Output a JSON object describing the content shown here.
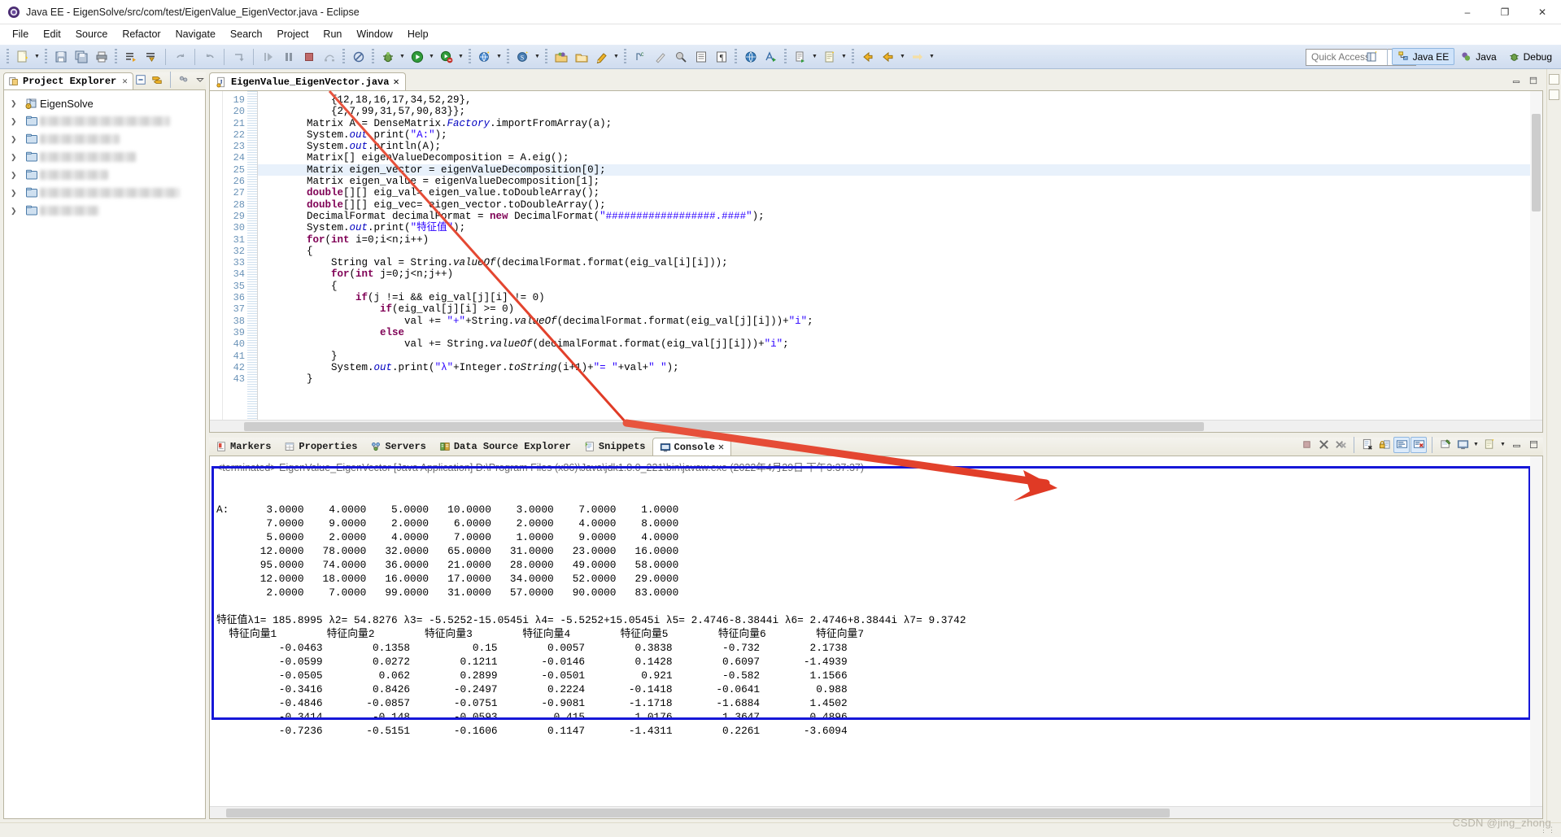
{
  "window": {
    "title": "Java EE - EigenSolve/src/com/test/EigenValue_EigenVector.java - Eclipse",
    "app_icon": "eclipse-icon",
    "minimize": "–",
    "maximize": "❐",
    "close": "✕"
  },
  "menubar": {
    "items": [
      "File",
      "Edit",
      "Source",
      "Refactor",
      "Navigate",
      "Search",
      "Project",
      "Run",
      "Window",
      "Help"
    ]
  },
  "toolbar": {
    "quick_access_placeholder": "Quick Access",
    "perspectives": [
      {
        "label": "Java EE",
        "icon": "java-ee-perspective-icon",
        "active": true
      },
      {
        "label": "Java",
        "icon": "java-perspective-icon",
        "active": false
      },
      {
        "label": "Debug",
        "icon": "debug-perspective-icon",
        "active": false
      }
    ],
    "open_perspective_icon": "open-perspective-icon",
    "buttons": [
      "new-icon",
      "save-icon",
      "save-all-icon",
      "print-icon",
      "build-all-icon",
      "skip-breakpoints-icon",
      "undo-icon",
      "redo-icon",
      "next-annotation-icon",
      "resume-icon",
      "suspend-icon",
      "terminate-icon",
      "step-icon",
      "disconnect-icon",
      "debug-icon",
      "run-icon",
      "run-error-icon",
      "new-java-ee-project-icon",
      "new-server-icon",
      "open-type-icon",
      "open-task-icon",
      "new-class-icon",
      "toggle-mark-occurrences-icon",
      "pencil-icon",
      "search-icon",
      "show-whitespace-icon",
      "pilcrow-icon",
      "web-browser-icon",
      "run-as-icon",
      "external-tools-icon",
      "new-wizard-icon",
      "back-icon",
      "forward-icon",
      "next-icon"
    ]
  },
  "project_explorer": {
    "title": "Project Explorer",
    "icon": "project-explorer-icon",
    "close_icon": "close-icon",
    "view_buttons": [
      "collapse-all-icon",
      "link-with-editor-icon",
      "view-menu-icon",
      "minimize-icon",
      "maximize-icon"
    ],
    "items": [
      {
        "label": "EigenSolve",
        "icon": "java-project-icon",
        "blurred": false,
        "blur_width": 0
      },
      {
        "label": "",
        "icon": "folder-icon",
        "blurred": true,
        "blur_width": 160
      },
      {
        "label": "",
        "icon": "folder-icon",
        "blurred": true,
        "blur_width": 98
      },
      {
        "label": "",
        "icon": "folder-icon",
        "blurred": true,
        "blur_width": 118
      },
      {
        "label": "",
        "icon": "folder-icon",
        "blurred": true,
        "blur_width": 84
      },
      {
        "label": "",
        "icon": "folder-icon",
        "blurred": true,
        "blur_width": 172
      },
      {
        "label": "",
        "icon": "folder-icon",
        "blurred": true,
        "blur_width": 73
      }
    ]
  },
  "editor": {
    "tab": {
      "label": "EigenValue_EigenVector.java",
      "icon": "java-file-icon",
      "close_icon": "close-icon"
    },
    "first_line_number": 19,
    "highlighted_line": 25,
    "lines": [
      {
        "n": 19,
        "indent": 12,
        "tokens": [
          {
            "t": "{12,18,16,17,34,52,29},",
            "c": "plain"
          }
        ]
      },
      {
        "n": 20,
        "indent": 12,
        "tokens": [
          {
            "t": "{2,7,99,31,57,90,83}};",
            "c": "plain"
          }
        ]
      },
      {
        "n": 21,
        "indent": 8,
        "tokens": [
          {
            "t": "Matrix A = DenseMatrix.",
            "c": "plain"
          },
          {
            "t": "Factory",
            "c": "fld"
          },
          {
            "t": ".importFromArray(a);",
            "c": "plain"
          }
        ]
      },
      {
        "n": 22,
        "indent": 8,
        "tokens": [
          {
            "t": "System.",
            "c": "plain"
          },
          {
            "t": "out",
            "c": "fld"
          },
          {
            "t": ".print(",
            "c": "plain"
          },
          {
            "t": "\"A:\"",
            "c": "str"
          },
          {
            "t": ");",
            "c": "plain"
          }
        ]
      },
      {
        "n": 23,
        "indent": 8,
        "tokens": [
          {
            "t": "System.",
            "c": "plain"
          },
          {
            "t": "out",
            "c": "fld"
          },
          {
            "t": ".println(A);",
            "c": "plain"
          }
        ]
      },
      {
        "n": 24,
        "indent": 8,
        "tokens": [
          {
            "t": "Matrix[] eigenValueDecomposition = A.eig();",
            "c": "plain"
          }
        ]
      },
      {
        "n": 25,
        "indent": 8,
        "tokens": [
          {
            "t": "Matrix eigen_vector = eigenValueDecomposition[0];",
            "c": "plain"
          }
        ]
      },
      {
        "n": 26,
        "indent": 8,
        "tokens": [
          {
            "t": "Matrix eigen_value = eigenValueDecomposition[1];",
            "c": "plain"
          }
        ]
      },
      {
        "n": 27,
        "indent": 8,
        "tokens": [
          {
            "t": "double",
            "c": "kw"
          },
          {
            "t": "[][] eig_val= eigen_value.toDoubleArray();",
            "c": "plain"
          }
        ]
      },
      {
        "n": 28,
        "indent": 8,
        "tokens": [
          {
            "t": "double",
            "c": "kw"
          },
          {
            "t": "[][] eig_vec= eigen_vector.toDoubleArray();",
            "c": "plain"
          }
        ]
      },
      {
        "n": 29,
        "indent": 8,
        "tokens": [
          {
            "t": "DecimalFormat decimalFormat = ",
            "c": "plain"
          },
          {
            "t": "new",
            "c": "kw"
          },
          {
            "t": " DecimalFormat(",
            "c": "plain"
          },
          {
            "t": "\"##################.####\"",
            "c": "str"
          },
          {
            "t": ");",
            "c": "plain"
          }
        ]
      },
      {
        "n": 30,
        "indent": 8,
        "tokens": [
          {
            "t": "System.",
            "c": "plain"
          },
          {
            "t": "out",
            "c": "fld"
          },
          {
            "t": ".print(",
            "c": "plain"
          },
          {
            "t": "\"特征值\"",
            "c": "str"
          },
          {
            "t": ");",
            "c": "plain"
          }
        ]
      },
      {
        "n": 31,
        "indent": 8,
        "tokens": [
          {
            "t": "for",
            "c": "kw"
          },
          {
            "t": "(",
            "c": "plain"
          },
          {
            "t": "int",
            "c": "kw"
          },
          {
            "t": " i=0;i<n;i++)",
            "c": "plain"
          }
        ]
      },
      {
        "n": 32,
        "indent": 8,
        "tokens": [
          {
            "t": "{",
            "c": "plain"
          }
        ]
      },
      {
        "n": 33,
        "indent": 12,
        "tokens": [
          {
            "t": "String val = String.",
            "c": "plain"
          },
          {
            "t": "valueOf",
            "c": "mth"
          },
          {
            "t": "(decimalFormat.format(eig_val[i][i]));",
            "c": "plain"
          }
        ]
      },
      {
        "n": 34,
        "indent": 12,
        "tokens": [
          {
            "t": "for",
            "c": "kw"
          },
          {
            "t": "(",
            "c": "plain"
          },
          {
            "t": "int",
            "c": "kw"
          },
          {
            "t": " j=0;j<n;j++)",
            "c": "plain"
          }
        ]
      },
      {
        "n": 35,
        "indent": 12,
        "tokens": [
          {
            "t": "{",
            "c": "plain"
          }
        ]
      },
      {
        "n": 36,
        "indent": 16,
        "tokens": [
          {
            "t": "if",
            "c": "kw"
          },
          {
            "t": "(j !=i && eig_val[j][i] != 0)",
            "c": "plain"
          }
        ]
      },
      {
        "n": 37,
        "indent": 20,
        "tokens": [
          {
            "t": "if",
            "c": "kw"
          },
          {
            "t": "(eig_val[j][i] >= 0)",
            "c": "plain"
          }
        ]
      },
      {
        "n": 38,
        "indent": 24,
        "tokens": [
          {
            "t": "val += ",
            "c": "plain"
          },
          {
            "t": "\"+\"",
            "c": "str"
          },
          {
            "t": "+String.",
            "c": "plain"
          },
          {
            "t": "valueOf",
            "c": "mth"
          },
          {
            "t": "(decimalFormat.format(eig_val[j][i]))+",
            "c": "plain"
          },
          {
            "t": "\"i\"",
            "c": "str"
          },
          {
            "t": ";",
            "c": "plain"
          }
        ]
      },
      {
        "n": 39,
        "indent": 20,
        "tokens": [
          {
            "t": "else",
            "c": "kw"
          }
        ]
      },
      {
        "n": 40,
        "indent": 24,
        "tokens": [
          {
            "t": "val += String.",
            "c": "plain"
          },
          {
            "t": "valueOf",
            "c": "mth"
          },
          {
            "t": "(decimalFormat.format(eig_val[j][i]))+",
            "c": "plain"
          },
          {
            "t": "\"i\"",
            "c": "str"
          },
          {
            "t": ";",
            "c": "plain"
          }
        ]
      },
      {
        "n": 41,
        "indent": 12,
        "tokens": [
          {
            "t": "}",
            "c": "plain"
          }
        ]
      },
      {
        "n": 42,
        "indent": 12,
        "tokens": [
          {
            "t": "System.",
            "c": "plain"
          },
          {
            "t": "out",
            "c": "fld"
          },
          {
            "t": ".print(",
            "c": "plain"
          },
          {
            "t": "\"λ\"",
            "c": "str"
          },
          {
            "t": "+Integer.",
            "c": "plain"
          },
          {
            "t": "toString",
            "c": "mth"
          },
          {
            "t": "(i+1)+",
            "c": "plain"
          },
          {
            "t": "\"= \"",
            "c": "str"
          },
          {
            "t": "+val+",
            "c": "plain"
          },
          {
            "t": "\" \"",
            "c": "str"
          },
          {
            "t": ");",
            "c": "plain"
          }
        ]
      },
      {
        "n": 43,
        "indent": 8,
        "tokens": [
          {
            "t": "}",
            "c": "plain"
          }
        ]
      }
    ]
  },
  "bottom_panel": {
    "tabs": [
      {
        "label": "Markers",
        "icon": "markers-icon",
        "active": false
      },
      {
        "label": "Properties",
        "icon": "properties-icon",
        "active": false
      },
      {
        "label": "Servers",
        "icon": "servers-icon",
        "active": false
      },
      {
        "label": "Data Source Explorer",
        "icon": "data-source-explorer-icon",
        "active": false
      },
      {
        "label": "Snippets",
        "icon": "snippets-icon",
        "active": false
      },
      {
        "label": "Console",
        "icon": "console-icon",
        "active": true,
        "close_icon": "close-icon"
      }
    ],
    "toolbar_buttons": [
      "terminate-icon",
      "remove-launch-icon",
      "remove-all-launches-icon",
      "clear-console-icon",
      "scroll-lock-icon",
      "show-console-on-output-icon",
      "show-console-on-error-icon",
      "pin-console-icon",
      "display-selected-console-icon",
      "open-console-icon",
      "minimize-icon",
      "maximize-icon"
    ],
    "terminated_line": "<terminated> EigenValue_EigenVector [Java Application] D:\\Program Files (x86)\\Java\\jdk1.8.0_221\\bin\\javaw.exe (2022年4月29日 下午3:37:37)"
  },
  "console_output": {
    "matrix_label": "A:",
    "matrix_rows": [
      [
        "3.0000",
        "4.0000",
        "5.0000",
        "10.0000",
        "3.0000",
        "7.0000",
        "1.0000"
      ],
      [
        "7.0000",
        "9.0000",
        "2.0000",
        "6.0000",
        "2.0000",
        "4.0000",
        "8.0000"
      ],
      [
        "5.0000",
        "2.0000",
        "4.0000",
        "7.0000",
        "1.0000",
        "9.0000",
        "4.0000"
      ],
      [
        "12.0000",
        "78.0000",
        "32.0000",
        "65.0000",
        "31.0000",
        "23.0000",
        "16.0000"
      ],
      [
        "95.0000",
        "74.0000",
        "36.0000",
        "21.0000",
        "28.0000",
        "49.0000",
        "58.0000"
      ],
      [
        "12.0000",
        "18.0000",
        "16.0000",
        "17.0000",
        "34.0000",
        "52.0000",
        "29.0000"
      ],
      [
        "2.0000",
        "7.0000",
        "99.0000",
        "31.0000",
        "57.0000",
        "90.0000",
        "83.0000"
      ]
    ],
    "eigenvalues_label": "特征值",
    "eigenvalues": [
      "λ1= 185.8995",
      "λ2= 54.8276",
      "λ3= -5.5252-15.0545i",
      "λ4= -5.5252+15.0545i",
      "λ5= 2.4746-8.3844i",
      "λ6= 2.4746+8.3844i",
      "λ7= 9.3742"
    ],
    "eigenvector_headers": [
      "特征向量1",
      "特征向量2",
      "特征向量3",
      "特征向量4",
      "特征向量5",
      "特征向量6",
      "特征向量7"
    ],
    "eigenvector_rows": [
      [
        "-0.0463",
        "0.1358",
        "0.15",
        "0.0057",
        "0.3838",
        "-0.732",
        "2.1738"
      ],
      [
        "-0.0599",
        "0.0272",
        "0.1211",
        "-0.0146",
        "0.1428",
        "0.6097",
        "-1.4939"
      ],
      [
        "-0.0505",
        "0.062",
        "0.2899",
        "-0.0501",
        "0.921",
        "-0.582",
        "1.1566"
      ],
      [
        "-0.3416",
        "0.8426",
        "-0.2497",
        "0.2224",
        "-0.1418",
        "-0.0641",
        "0.988"
      ],
      [
        "-0.4846",
        "-0.0857",
        "-0.0751",
        "-0.9081",
        "-1.1718",
        "-1.6884",
        "1.4502"
      ],
      [
        "-0.3414",
        "-0.148",
        "-0.0593",
        "0.415",
        "1.0176",
        "1.3647",
        "0.4896"
      ],
      [
        "-0.7236",
        "-0.5151",
        "-0.1606",
        "0.1147",
        "-1.4311",
        "0.2261",
        "-3.6094"
      ]
    ]
  },
  "annotations": {
    "highlight_box_color": "#1617d8",
    "arrow_color": "#e8422f"
  },
  "watermark": "CSDN @jing_zhong"
}
